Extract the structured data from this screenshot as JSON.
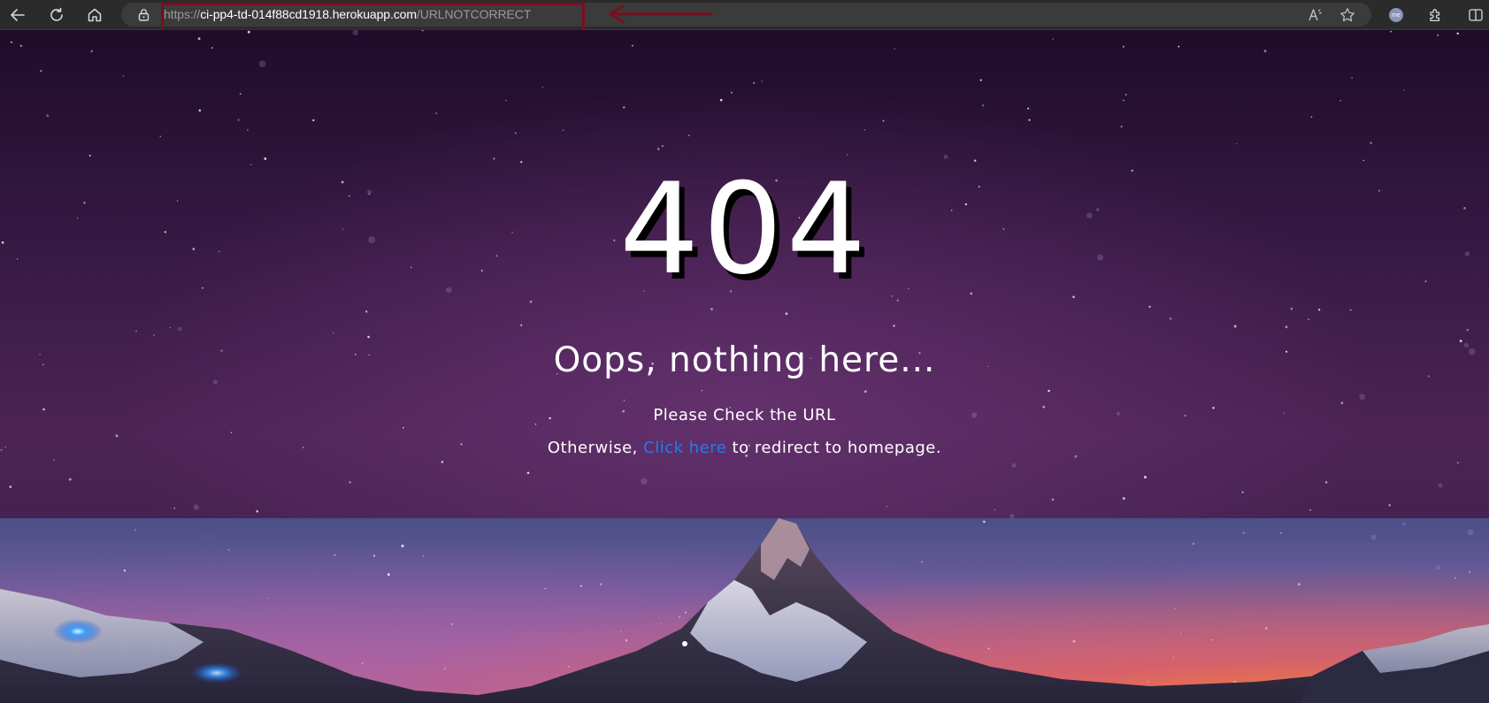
{
  "browser": {
    "url_scheme": "https://",
    "url_host": "ci-pp4-td-014f88cd1918.herokuapp.com",
    "url_path": "/URLNOTCORRECT",
    "icons": [
      "back-icon",
      "refresh-icon",
      "home-icon",
      "lock-icon",
      "read-aloud-icon",
      "favorite-star-icon",
      "profile-avatar-icon",
      "extensions-icon",
      "split-screen-icon"
    ],
    "profile_initials": "me"
  },
  "annotation": {
    "color": "#7a0f1c"
  },
  "page": {
    "error_code": "404",
    "title": "Oops, nothing here...",
    "message": "Please Check the URL",
    "redirect_prefix": "Otherwise,",
    "link_label": "Click here",
    "redirect_suffix": "to redirect to homepage.",
    "link_color": "#1e7ef0"
  }
}
